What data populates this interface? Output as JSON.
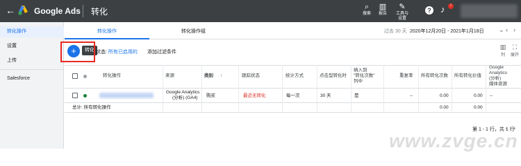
{
  "topbar": {
    "app_name": "Google Ads",
    "page_title": "转化",
    "search_label": "搜索",
    "reports_label": "报告",
    "tools_label_1": "工具与",
    "tools_label_2": "设置",
    "help_symbol": "?",
    "badge": "!",
    "logo_colors": [
      "#fbbc04",
      "#4285f4",
      "#34a853"
    ]
  },
  "sidebar": {
    "items": [
      {
        "label": "转化操作"
      },
      {
        "label": "设置"
      },
      {
        "label": "上传"
      },
      {
        "label": "Salesforce"
      }
    ]
  },
  "tabs": [
    {
      "label": "转化操作"
    },
    {
      "label": "转化操作组"
    }
  ],
  "date": {
    "prefix": "过去 30 天",
    "range": "2020年12月20日 - 2021年1月18日"
  },
  "toolbar": {
    "add_symbol": "+",
    "tooltip": "转化",
    "filter_prefix": "状态:",
    "filter_value": "所有已启用的",
    "add_filter": "添加过滤条件",
    "columns_label": "列",
    "expand_label": "展开"
  },
  "table": {
    "headers": {
      "action": "转化操作",
      "source": "来源",
      "category": "类别",
      "category_sort": "↑",
      "tracking": "跟踪状态",
      "count": "统计方式",
      "window": "点击型转化时",
      "include_1": "纳入到",
      "include_2": "\"转化次数\"",
      "include_3": "列中",
      "repeat": "重复率",
      "all_conv": "所有转化次数",
      "all_value": "所有转化价值",
      "ga_1": "Google",
      "ga_2": "Analytics",
      "ga_3": "(分析)",
      "ga_4": "媒体资源"
    },
    "row": {
      "source_1": "Google Analytics",
      "source_2": "(分析) (GA4)",
      "category": "购买",
      "tracking": "最近无转化",
      "count": "每一次",
      "window": "30 天",
      "include": "是",
      "repeat": "--",
      "all_conv": "0.00",
      "all_value": "0.00",
      "ga": "--"
    },
    "total": {
      "label": "总计: 所有转化操作",
      "all_conv": "0.00",
      "all_value": "0.00"
    },
    "status_dot_color": "#188038",
    "tracking_color": "#d93025"
  },
  "pager": {
    "text": "第 1 - 1 行，共 1 行"
  },
  "watermark": "www.zvge.cn"
}
